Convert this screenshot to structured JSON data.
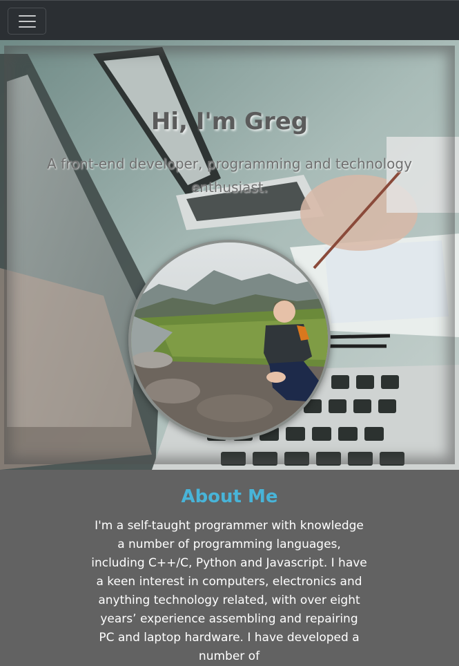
{
  "navbar": {
    "toggler_icon": "hamburger-menu-icon"
  },
  "hero": {
    "title": "Hi, I'm Greg",
    "subtitle": "A front-end developer, programming and technology enthusiast.",
    "background_image": "laptops-on-desk-photo",
    "portrait_image": "greg-outdoors-portrait-photo"
  },
  "about": {
    "title": "About Me",
    "text": "I'm a self-taught programmer with knowledge a number of programming languages, including C++/C, Python and Javascript. I have a keen interest in computers, electronics and anything technology related, with over eight years’ experience assembling and repairing PC and laptop hardware. I have developed a number of"
  },
  "colors": {
    "navbar_bg": "#2b2f33",
    "page_bg": "#626262",
    "accent": "#48b4d8"
  }
}
